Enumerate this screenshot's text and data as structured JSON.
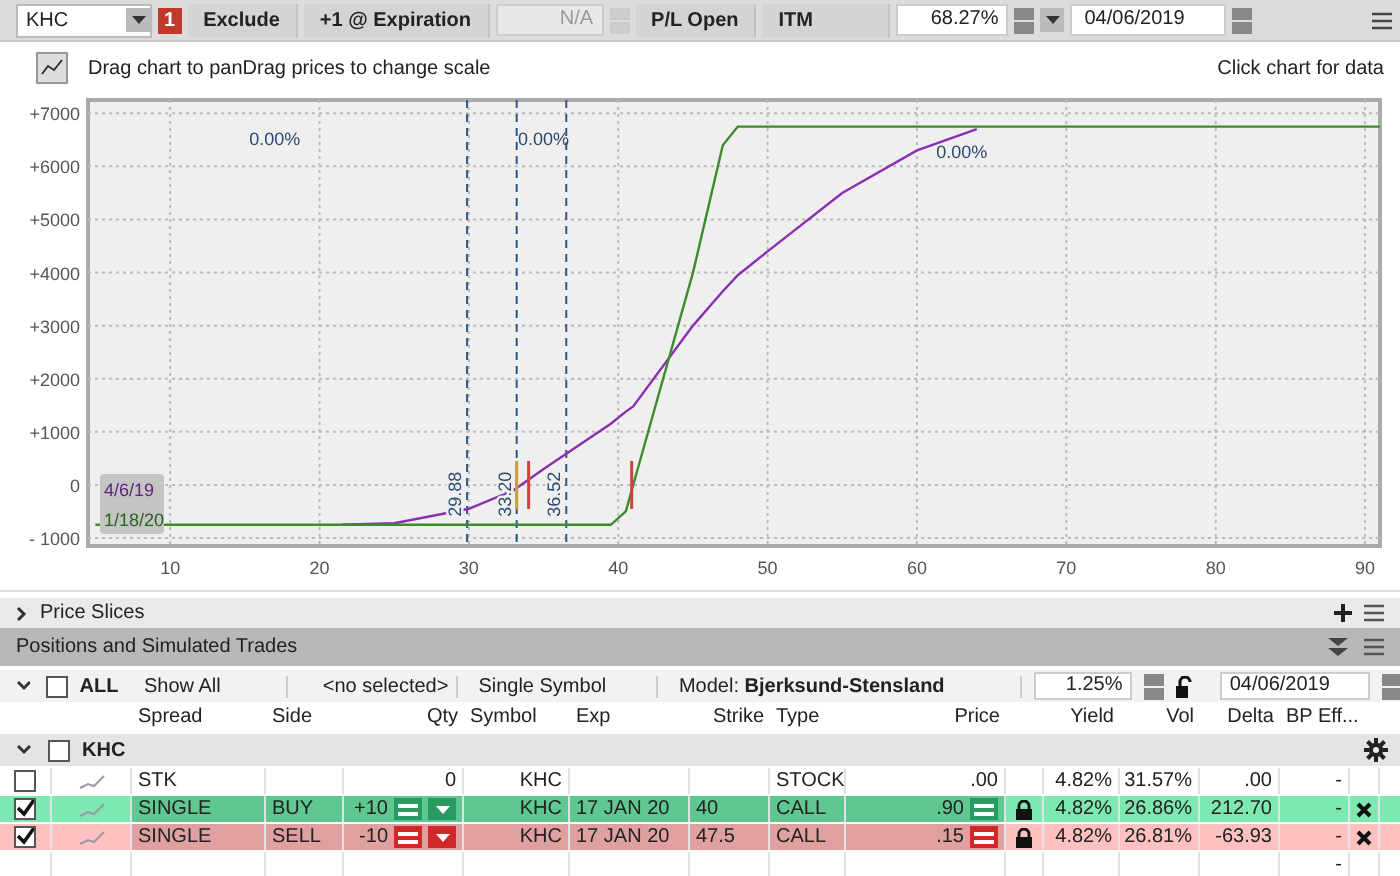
{
  "toolbar": {
    "symbol": "KHC",
    "alert_badge": "1",
    "exclude": "Exclude",
    "expiration": "+1 @ Expiration",
    "step": {
      "value": "N/A",
      "disabled": true
    },
    "pl_mode": "P/L Open",
    "itm": "ITM",
    "probability": "68.27%",
    "date": "04/06/2019"
  },
  "chart_header": {
    "hint": "Drag chart to panDrag prices to change scale",
    "right": "Click chart for data"
  },
  "chart": {
    "chart_data": {
      "type": "line",
      "x": [
        5,
        21.5,
        25,
        30,
        33,
        35,
        39.5,
        40.5,
        41,
        45,
        47,
        48,
        50,
        55,
        60,
        64,
        91
      ],
      "series": [
        {
          "name": "4/6/19",
          "color": "#8a2fb0",
          "values": [
            null,
            -750,
            -720,
            -450,
            -100,
            300,
            1150,
            1380,
            1480,
            3000,
            3650,
            3950,
            4400,
            5500,
            6300,
            6700,
            null
          ]
        },
        {
          "name": "1/18/20",
          "color": "#3c8c2c",
          "values": [
            -750,
            -750,
            -750,
            -750,
            -750,
            -750,
            -750,
            -500,
            0,
            4000,
            6400,
            6750,
            6750,
            6750,
            6750,
            6750,
            6750
          ]
        }
      ],
      "xlim": [
        4.5,
        91
      ],
      "ylim": [
        -1150,
        7250
      ],
      "xticks": [
        10,
        20,
        30,
        40,
        50,
        60,
        70,
        80,
        90
      ],
      "yticks": [
        {
          "value": 7000,
          "label": "+7000"
        },
        {
          "value": 6000,
          "label": "+6000"
        },
        {
          "value": 5000,
          "label": "+5000"
        },
        {
          "value": 4000,
          "label": "+4000"
        },
        {
          "value": 3000,
          "label": "+3000"
        },
        {
          "value": 2000,
          "label": "+2000"
        },
        {
          "value": 1000,
          "label": "+1000"
        },
        {
          "value": 0,
          "label": "0"
        },
        {
          "value": -1000,
          "label": "- 1000"
        }
      ],
      "grid": true,
      "ref_lines": [
        {
          "axis": "x",
          "value": 29.88,
          "label": "29.88"
        },
        {
          "axis": "x",
          "value": 33.2,
          "label": "33.20"
        },
        {
          "axis": "x",
          "value": 36.52,
          "label": "36.52"
        }
      ],
      "annotations": [
        "0.00%",
        "0.00%",
        "0.00%"
      ]
    }
  },
  "price_slices": {
    "label": "Price Slices",
    "expanded": false
  },
  "positions": {
    "title": "Positions and Simulated Trades",
    "filter": {
      "all_label": "ALL",
      "all_checked": false,
      "show": "Show All",
      "selected": "<no selected>",
      "mode": "Single Symbol",
      "model_label": "Model:",
      "model": "Bjerksund-Stensland",
      "rate": "1.25%",
      "date": "04/06/2019"
    },
    "columns": [
      "Spread",
      "Side",
      "Qty",
      "Symbol",
      "Exp",
      "Strike",
      "Type",
      "Price",
      "Yield",
      "Vol",
      "Delta",
      "BP Eff..."
    ],
    "group": {
      "name": "KHC",
      "checked": false,
      "expanded": true
    },
    "rows": [
      {
        "kind": "stock",
        "checked": false,
        "spread": "STK",
        "side": "",
        "qty": "0",
        "symbol": "KHC",
        "exp": "",
        "strike": "",
        "type": "STOCK",
        "price": ".00",
        "yield": "4.82%",
        "vol": "31.57%",
        "delta": ".00",
        "bp": "-"
      },
      {
        "kind": "buy",
        "checked": true,
        "spread": "SINGLE",
        "side": "BUY",
        "qty": "+10",
        "symbol": "KHC",
        "exp": "17 JAN 20",
        "strike": "40",
        "type": "CALL",
        "price": ".90",
        "yield": "4.82%",
        "vol": "26.86%",
        "delta": "212.70",
        "bp": "-"
      },
      {
        "kind": "sell",
        "checked": true,
        "spread": "SINGLE",
        "side": "SELL",
        "qty": "-10",
        "symbol": "KHC",
        "exp": "17 JAN 20",
        "strike": "47.5",
        "type": "CALL",
        "price": ".15",
        "yield": "4.82%",
        "vol": "26.81%",
        "delta": "-63.93",
        "bp": "-"
      }
    ],
    "blank_row_bp": "-"
  }
}
